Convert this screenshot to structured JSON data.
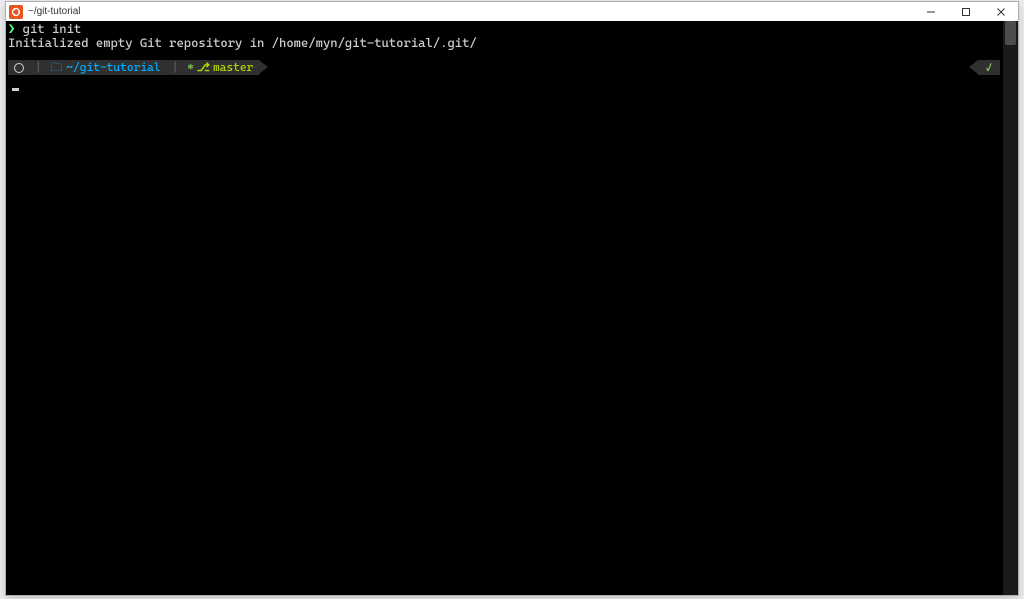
{
  "window": {
    "title": "~/git-tutorial"
  },
  "terminal": {
    "prompt_symbol": "❯",
    "command": "git init",
    "output": "Initialized empty Git repository in /home/myn/git-tutorial/.git/"
  },
  "powerline": {
    "separator": "|",
    "folder_icon": "🗀",
    "path": "~/git-tutorial",
    "git_icon": "",
    "branch_icon": "⎇",
    "branch": "master",
    "status_ok": "✓"
  }
}
